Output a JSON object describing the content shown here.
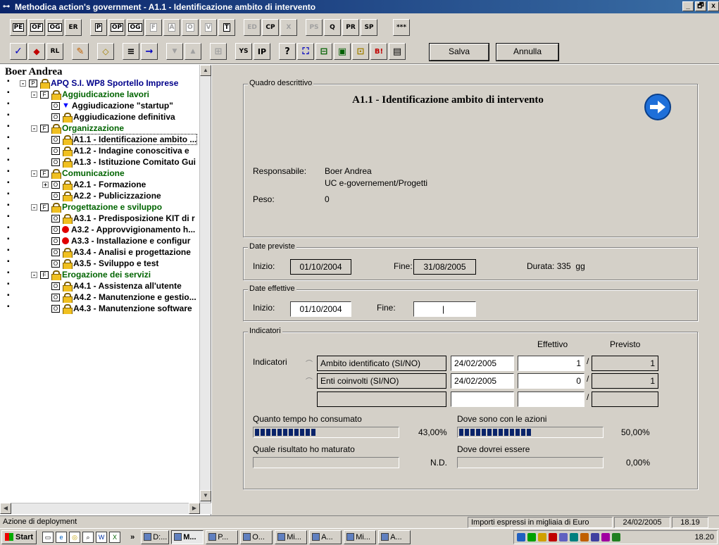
{
  "window": {
    "title": "Methodica action's government - A1.1 - Identificazione ambito di intervento",
    "controls": [
      "_",
      "🗗",
      "x"
    ]
  },
  "toolbar": {
    "row1": [
      "PE",
      "OF",
      "OG",
      "ER",
      "P",
      "OP",
      "OG",
      "F",
      "A",
      "O",
      "V",
      "T",
      "ED",
      "CP",
      "X",
      "PS",
      "Q",
      "PR",
      "SP",
      "***"
    ],
    "row2": [
      "✓",
      "◆",
      "RL",
      "✎",
      "◇",
      "≡",
      "→",
      "▼",
      "▲",
      "⊞",
      "YS",
      "IP",
      "?",
      "⛶",
      "⊟",
      "▣",
      "⊡",
      "B!",
      "▤"
    ],
    "save_label": "Salva",
    "cancel_label": "Annulla"
  },
  "left": {
    "user": "Boer Andrea",
    "tree": [
      {
        "level": 0,
        "text": "APQ S.I. WP8 Sportello Imprese",
        "box": "P",
        "icon": "lock",
        "color": "blue",
        "exp": "-"
      },
      {
        "level": 1,
        "text": "Aggiudicazione lavori",
        "box": "F",
        "icon": "lock",
        "color": "green",
        "exp": "-"
      },
      {
        "level": 2,
        "text": "Aggiudicazione \"startup\"",
        "box": "O",
        "icon": "tri",
        "color": "black"
      },
      {
        "level": 2,
        "text": "Aggiudicazione definitiva",
        "box": "O",
        "icon": "lock",
        "color": "black"
      },
      {
        "level": 1,
        "text": "Organizzazione",
        "box": "F",
        "icon": "lock",
        "color": "green",
        "exp": "-"
      },
      {
        "level": 2,
        "text": "A1.1 - Identificazione ambito ...",
        "box": "O",
        "icon": "lock",
        "color": "black",
        "selected": true
      },
      {
        "level": 2,
        "text": "A1.2 - Indagine conoscitiva e",
        "box": "O",
        "icon": "lock",
        "color": "black"
      },
      {
        "level": 2,
        "text": "A1.3 - Istituzione Comitato Gui",
        "box": "O",
        "icon": "lock",
        "color": "black"
      },
      {
        "level": 1,
        "text": "Comunicazione",
        "box": "F",
        "icon": "lock",
        "color": "green",
        "exp": "-"
      },
      {
        "level": 2,
        "text": "A2.1 - Formazione",
        "box": "O",
        "icon": "lock",
        "color": "black",
        "exp": "+"
      },
      {
        "level": 2,
        "text": "A2.2 - Publicizzazione",
        "box": "O",
        "icon": "lock",
        "color": "black"
      },
      {
        "level": 1,
        "text": "Progettazione e sviluppo",
        "box": "F",
        "icon": "lock",
        "color": "green",
        "exp": "-"
      },
      {
        "level": 2,
        "text": "A3.1 - Predisposizione KIT di r",
        "box": "O",
        "icon": "lock",
        "color": "black"
      },
      {
        "level": 2,
        "text": "A3.2 - Approvvigionamento h...",
        "box": "O",
        "icon": "red",
        "color": "black"
      },
      {
        "level": 2,
        "text": "A3.3 - Installazione e configur",
        "box": "O",
        "icon": "red",
        "color": "black"
      },
      {
        "level": 2,
        "text": "A3.4 - Analisi e progettazione",
        "box": "O",
        "icon": "lock",
        "color": "black"
      },
      {
        "level": 2,
        "text": "A3.5 - Sviluppo e test",
        "box": "O",
        "icon": "lock",
        "color": "black"
      },
      {
        "level": 1,
        "text": "Erogazione dei servizi",
        "box": "F",
        "icon": "lock",
        "color": "green",
        "exp": "-"
      },
      {
        "level": 2,
        "text": "A4.1 - Assistenza all'utente",
        "box": "O",
        "icon": "lock",
        "color": "black"
      },
      {
        "level": 2,
        "text": "A4.2 - Manutenzione e gestio...",
        "box": "O",
        "icon": "lock",
        "color": "black"
      },
      {
        "level": 2,
        "text": "A4.3 - Manutenzione software",
        "box": "O",
        "icon": "lock",
        "color": "black"
      }
    ]
  },
  "quadro": {
    "legend": "Quadro descrittivo",
    "title": "A1.1 - Identificazione ambito di intervento",
    "responsabile_label": "Responsabile:",
    "responsabile_name": "Boer Andrea",
    "responsabile_unit": "UC e-governement/Progetti",
    "peso_label": "Peso:",
    "peso_value": "0"
  },
  "previste": {
    "legend": "Date previste",
    "inizio_label": "Inizio:",
    "inizio_value": "01/10/2004",
    "fine_label": "Fine:",
    "fine_value": "31/08/2005",
    "durata_label": "Durata:",
    "durata_value": "335",
    "durata_unit": "gg"
  },
  "effettive": {
    "legend": "Date effettive",
    "inizio_label": "Inizio:",
    "inizio_value": "01/10/2004",
    "fine_label": "Fine:",
    "fine_value": "|"
  },
  "indicatori": {
    "legend": "Indicatori",
    "side_label": "Indicatori",
    "col_effettivo": "Effettivo",
    "col_previsto": "Previsto",
    "rows": [
      {
        "name": "Ambito identificato (SI/NO)",
        "date": "24/02/2005",
        "effettivo": "1",
        "sep": "/",
        "previsto": "1"
      },
      {
        "name": "Enti coinvolti (SI/NO)",
        "date": "24/02/2005",
        "effettivo": "0",
        "sep": "/",
        "previsto": "1"
      },
      {
        "name": "",
        "date": "",
        "effettivo": "",
        "sep": "/",
        "previsto": ""
      }
    ],
    "tempo_label": "Quanto tempo ho consumato",
    "tempo_value": "43,00%",
    "tempo_fraction": 0.43,
    "azioni_label": "Dove sono con le azioni",
    "azioni_value": "50,00%",
    "azioni_fraction": 0.5,
    "risultato_label": "Quale risultato ho maturato",
    "risultato_value": "N.D.",
    "risultato_fraction": 0,
    "dovrei_label": "Dove dovrei essere",
    "dovrei_value": "0,00%",
    "dovrei_fraction": 0
  },
  "status": {
    "left": "Azione di deployment",
    "importi": "Importi espressi in migliaia di Euro",
    "date": "24/02/2005",
    "time": "18.19"
  },
  "taskbar": {
    "start": "Start",
    "chevron": "»",
    "tasks": [
      "D:...",
      "M...",
      "P...",
      "O...",
      "Mi...",
      "A...",
      "Mi...",
      "A..."
    ],
    "active_index": 1,
    "clock": "18.20"
  },
  "colors": {
    "title_start": "#0a246a",
    "title_end": "#3a6ea5",
    "progress": "#0a246a",
    "face": "#d4d0c8",
    "arrow": "#1e6fd9"
  }
}
